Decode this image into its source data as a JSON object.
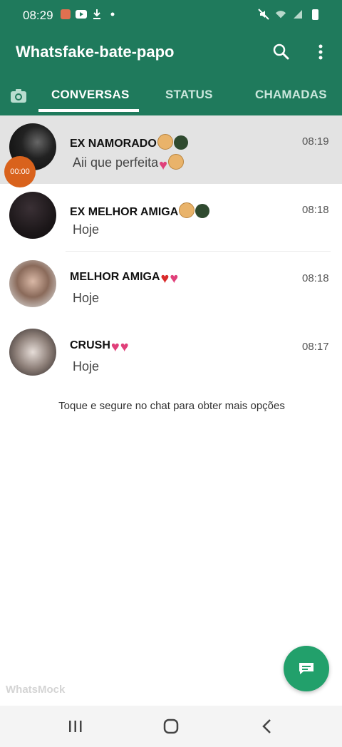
{
  "status_bar": {
    "time": "08:29",
    "left_icons": [
      "photo-icon",
      "youtube-icon",
      "download-icon",
      "dot-icon"
    ],
    "right_icons": [
      "mute-icon",
      "wifi-icon",
      "signal-icon",
      "battery-icon"
    ]
  },
  "app_bar": {
    "title": "Whatsfake-bate-papo",
    "icons": [
      "search-icon",
      "more-vert-icon"
    ]
  },
  "tabs": {
    "camera_icon": "camera-icon",
    "items": [
      {
        "label": "CONVERSAS",
        "selected": true
      },
      {
        "label": "STATUS",
        "selected": false
      },
      {
        "label": "CHAMADAS",
        "selected": false
      }
    ]
  },
  "chats": [
    {
      "name": "EX NAMORADO",
      "preview": "Aii que perfeita",
      "time": "08:19",
      "emojis": [
        "rolling-eyes-emoji",
        "dark-orb-emoji"
      ],
      "preview_emojis": [
        "heart-emoji",
        "face-emoji"
      ]
    },
    {
      "name": "EX MELHOR AMIGA",
      "preview": "Hoje",
      "time": "08:18",
      "emojis": [
        "rolling-eyes-emoji",
        "dark-orb-emoji"
      ]
    },
    {
      "name": "MELHOR AMIGA",
      "preview": "Hoje",
      "time": "08:18",
      "emojis": [
        "red-heart-emoji",
        "sparkling-heart-emoji"
      ]
    },
    {
      "name": "CRUSH",
      "preview": "Hoje",
      "time": "08:17",
      "emojis": [
        "sparkling-heart-emoji",
        "two-hearts-emoji"
      ]
    }
  ],
  "timer_badge": "00:00",
  "hint": "Toque e segure no chat para obter mais opções",
  "fab_icon": "new-chat-icon",
  "watermark": "WhatsMock",
  "nav_bar": [
    "recent-apps-icon",
    "home-icon",
    "back-icon"
  ],
  "colors": {
    "primary": "#1f7a5c",
    "fab": "#22a06b",
    "timer": "#d9621c"
  }
}
